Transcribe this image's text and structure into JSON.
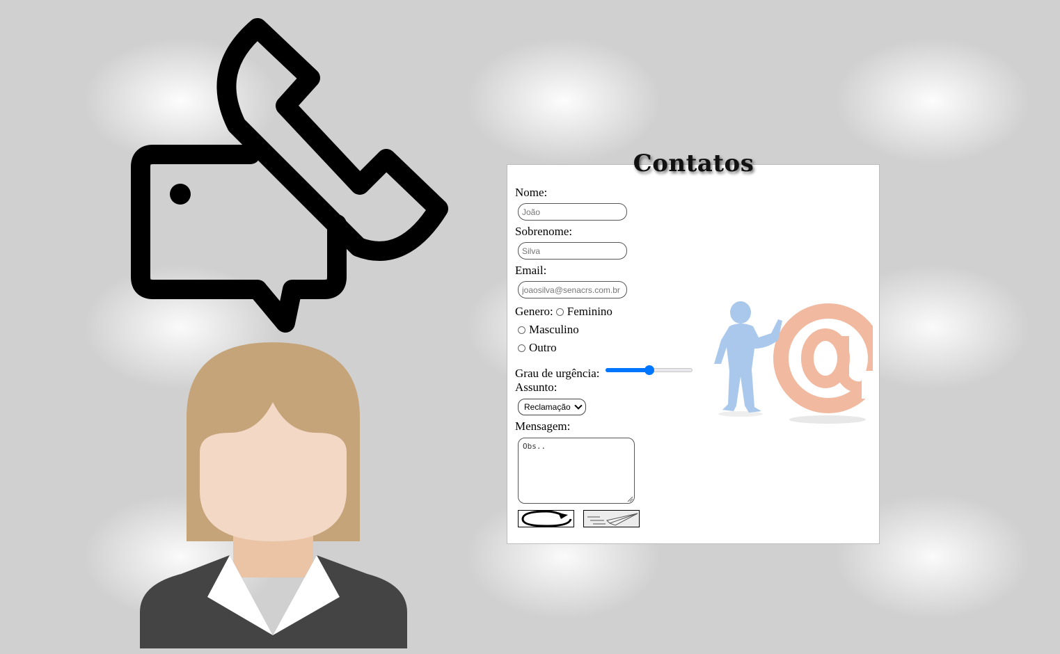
{
  "title": "Contatos",
  "form": {
    "nome": {
      "label": "Nome:",
      "placeholder": "João"
    },
    "sobrenome": {
      "label": "Sobrenome:",
      "placeholder": "Silva"
    },
    "email": {
      "label": "Email:",
      "placeholder": "joaosilva@senacrs.com.br"
    },
    "genero": {
      "label": "Genero:",
      "options": [
        "Feminino",
        "Masculino",
        "Outro"
      ]
    },
    "urgencia": {
      "label": "Grau de urgência:",
      "value_fraction": 0.5
    },
    "assunto": {
      "label": "Assunto:",
      "selected": "Reclamação"
    },
    "mensagem": {
      "label": "Mensagem:",
      "placeholder": "Obs.."
    }
  },
  "buttons": {
    "reset_icon": "refresh-icon",
    "send_icon": "paper-plane-icon"
  },
  "colors": {
    "slider_accent": "#0075ff",
    "hair": "#c5a47a",
    "skin": "#f2d8c5",
    "neck": "#ebc4a6",
    "suit": "#444444",
    "figure_blue": "#a9c8ec",
    "at_sign": "#f0b9a0"
  },
  "icons": [
    "phone-chat-icon",
    "support-agent-illustration",
    "email-person-illustration"
  ]
}
